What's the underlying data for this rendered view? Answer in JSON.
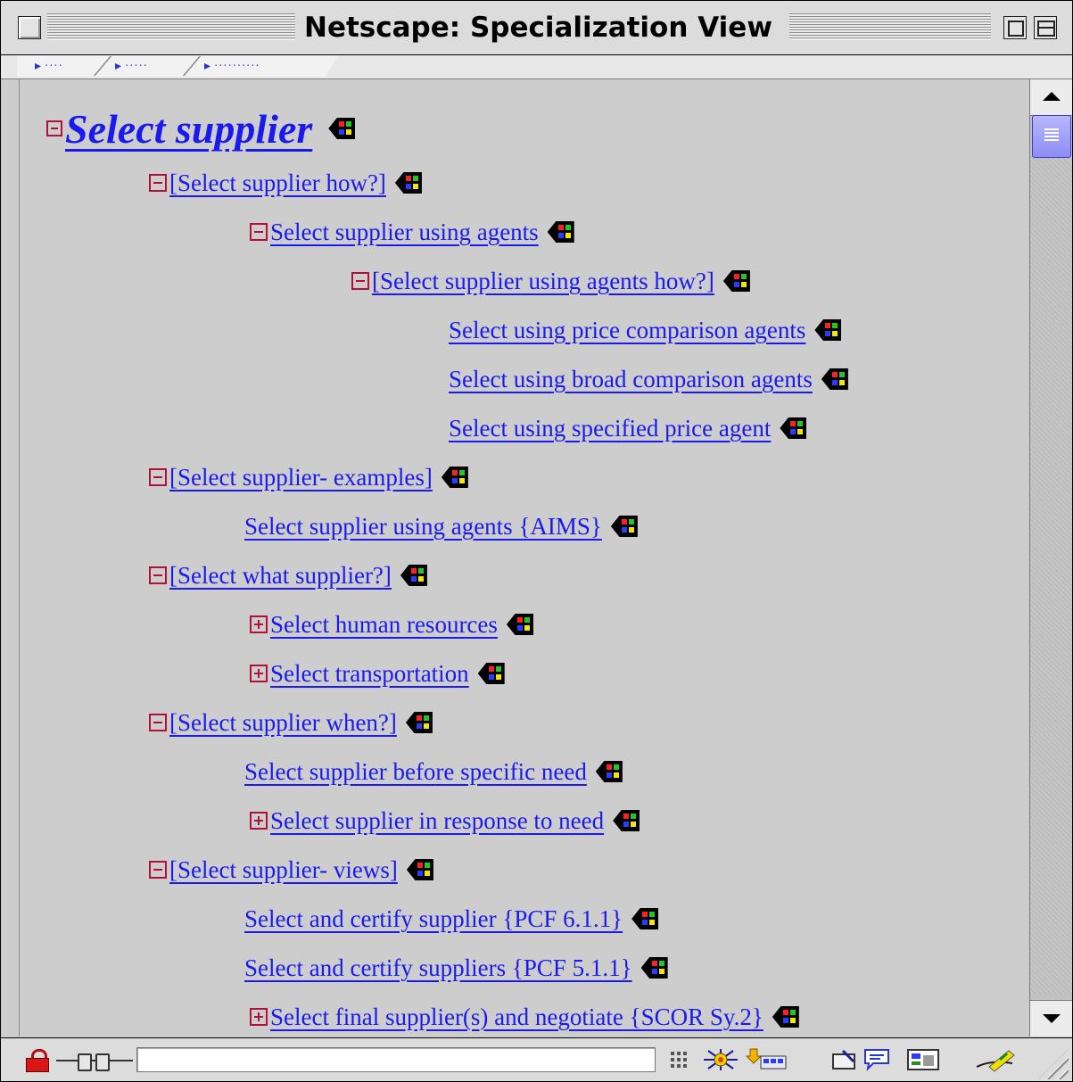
{
  "window": {
    "title": "Netscape: Specialization View"
  },
  "navigation": {
    "crumbs": [
      {
        "arrow": "▸",
        "dots": "····"
      },
      {
        "arrow": "▸",
        "dots": "·····"
      },
      {
        "arrow": "▸",
        "dots": "··········"
      }
    ]
  },
  "tree": {
    "root": "Select supplier",
    "items": [
      {
        "label": "[Select supplier how?]",
        "toggle": "minus"
      },
      {
        "label": "Select supplier using agents",
        "toggle": "minus"
      },
      {
        "label": "[Select supplier using agents how?]",
        "toggle": "minus"
      },
      {
        "label": "Select using price comparison agents",
        "toggle": "none"
      },
      {
        "label": "Select using broad comparison agents",
        "toggle": "none"
      },
      {
        "label": "Select using specified price agent",
        "toggle": "none"
      },
      {
        "label": "[Select supplier- examples]",
        "toggle": "minus"
      },
      {
        "label": "Select supplier using agents {AIMS}",
        "toggle": "none"
      },
      {
        "label": "[Select what supplier?]",
        "toggle": "minus"
      },
      {
        "label": "Select human resources",
        "toggle": "plus"
      },
      {
        "label": "Select transportation",
        "toggle": "plus"
      },
      {
        "label": "[Select supplier when?]",
        "toggle": "minus"
      },
      {
        "label": "Select supplier before specific need",
        "toggle": "none"
      },
      {
        "label": "Select supplier in response to need",
        "toggle": "plus"
      },
      {
        "label": "[Select supplier- views]",
        "toggle": "minus"
      },
      {
        "label": "Select and certify supplier {PCF 6.1.1}",
        "toggle": "none"
      },
      {
        "label": "Select and certify suppliers {PCF 5.1.1}",
        "toggle": "none"
      },
      {
        "label": "Select final supplier(s) and negotiate {SCOR Sy.2}",
        "toggle": "plus"
      }
    ]
  },
  "icons": {
    "tag": "tag-icon",
    "tag_colors": [
      "#ff2020",
      "#22c822",
      "#2a3dff",
      "#f5e600"
    ],
    "status": [
      "security-lock-icon",
      "connection-plug-icon",
      "grid-icon",
      "network-icon",
      "download-icon",
      "composer-icon",
      "chat-icon",
      "address-book-icon",
      "editor-pen-icon"
    ]
  },
  "colors": {
    "link": "#1a1aee",
    "toggle": "#b0103a",
    "background": "#cdcdcd"
  },
  "statusbar": {
    "message": ""
  }
}
